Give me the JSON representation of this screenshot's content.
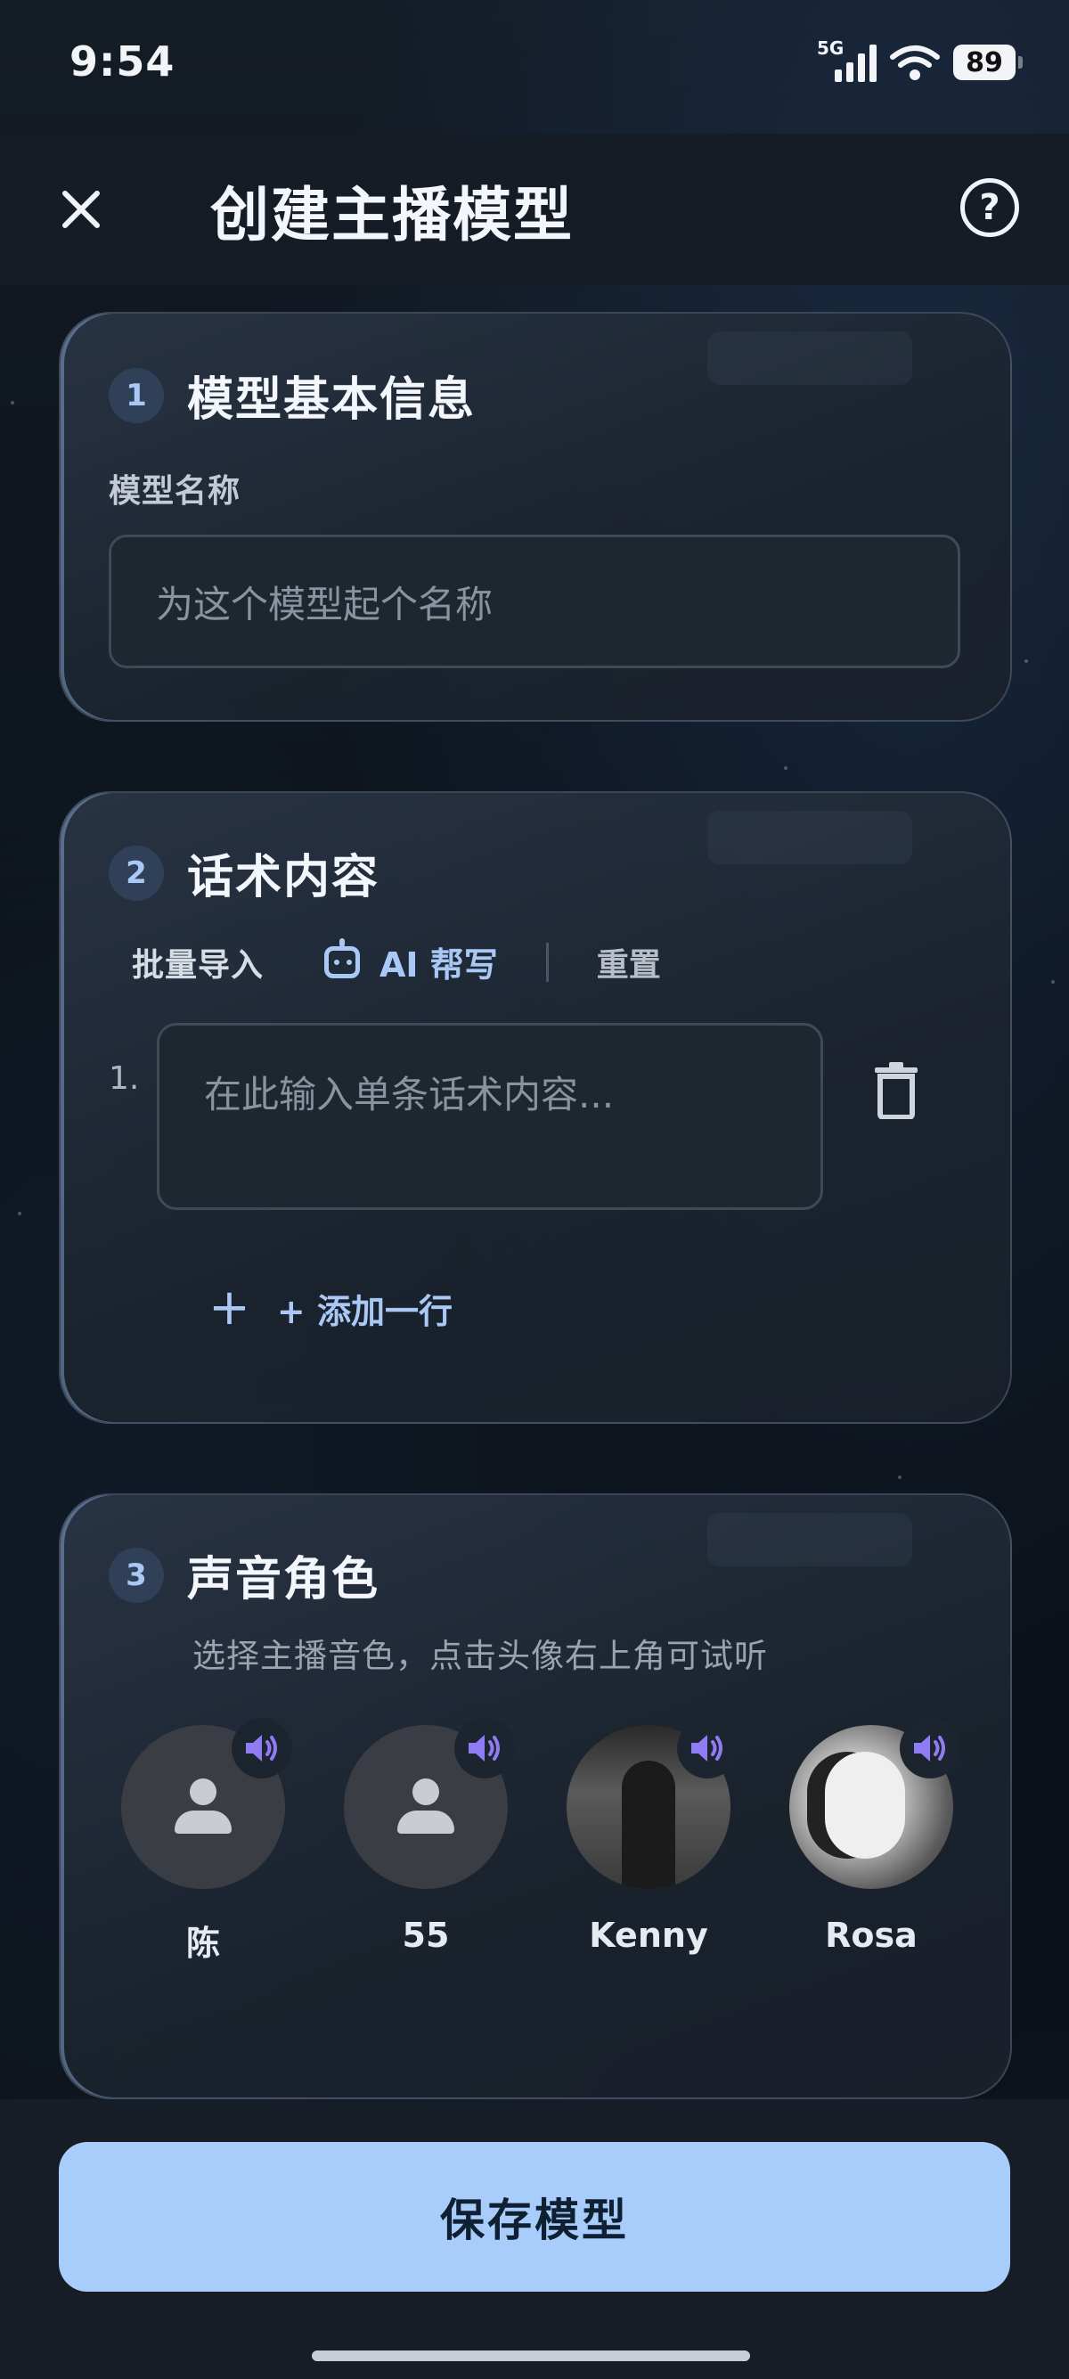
{
  "status_bar": {
    "time": "9:54",
    "network": "5G",
    "battery": "89"
  },
  "header": {
    "title": "创建主播模型",
    "close_icon": "close-icon",
    "help_icon": "help-icon"
  },
  "section1": {
    "number": "1",
    "title": "模型基本信息",
    "name_label": "模型名称",
    "name_placeholder": "为这个模型起个名称",
    "name_value": ""
  },
  "section2": {
    "number": "2",
    "title": "话术内容",
    "toolbar": {
      "batch_import": "批量导入",
      "ai_write": "AI 帮写",
      "reset": "重置"
    },
    "lines": [
      {
        "index": "1.",
        "placeholder": "在此输入单条话术内容...",
        "value": ""
      }
    ],
    "add_line": "+ 添加一行"
  },
  "section3": {
    "number": "3",
    "title": "声音角色",
    "subtitle": "选择主播音色，点击头像右上角可试听",
    "voices": [
      {
        "name": "陈",
        "avatar": "default-person"
      },
      {
        "name": "55",
        "avatar": "default-person"
      },
      {
        "name": "Kenny",
        "avatar": "photo"
      },
      {
        "name": "Rosa",
        "avatar": "photo"
      }
    ]
  },
  "footer": {
    "save_label": "保存模型"
  },
  "colors": {
    "accent": "#a8cdfb",
    "speaker_icon": "#8f7cf5",
    "background": "#0c1219"
  }
}
